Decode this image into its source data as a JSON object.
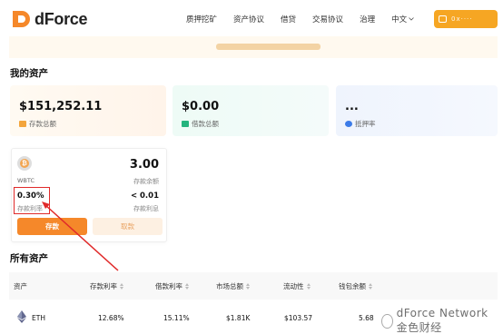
{
  "header": {
    "logo_text": "dForce",
    "nav": [
      "质押挖矿",
      "资产协议",
      "借贷",
      "交易协议",
      "治理"
    ],
    "language": "中文",
    "wallet_button_text": "0x····"
  },
  "sections": {
    "my_assets": "我的资产",
    "all_assets": "所有资产"
  },
  "summary": [
    {
      "amount": "$151,252.11",
      "label": "存款总额",
      "icon_color": "#f3a53c"
    },
    {
      "amount": "$0.00",
      "label": "借款总额",
      "icon_color": "#24b47e"
    },
    {
      "amount": "...",
      "label": "抵押率",
      "icon_color": "#3c7be8"
    }
  ],
  "asset_card": {
    "symbol": "WBTC",
    "coin_glyph": "₿",
    "balance": "3.00",
    "balance_label": "存款余额",
    "rate": "0.30%",
    "rate_label": "存款利率",
    "interest": "< 0.01",
    "interest_label": "存款利息",
    "deposit_button": "存款",
    "withdraw_button": "取款"
  },
  "table": {
    "headers": [
      "资产",
      "存款利率",
      "借款利率",
      "市场总额",
      "流动性",
      "钱包余额"
    ],
    "rows": [
      {
        "asset": "ETH",
        "deposit_rate": "12.68%",
        "borrow_rate": "15.11%",
        "market_total": "$1.81K",
        "liquidity": "$103.57",
        "wallet_balance": "5.68"
      }
    ]
  },
  "watermark": "dForce Network 金色财经",
  "colors": {
    "accent": "#f5882a",
    "annotation": "#e02a2a"
  }
}
